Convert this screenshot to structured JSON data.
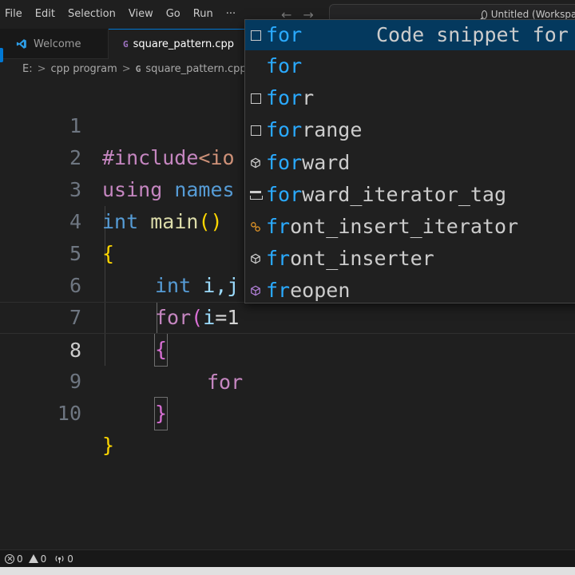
{
  "menubar": {
    "items": [
      "File",
      "Edit",
      "Selection",
      "View",
      "Go",
      "Run",
      "···"
    ],
    "back_arrow": "←",
    "forward_arrow": "→",
    "command_center_text": "Untitled (Workspace)"
  },
  "tabs": [
    {
      "label": "Welcome",
      "icon": "vscode-logo-icon",
      "active": false
    },
    {
      "label": "square_pattern.cpp",
      "icon": "cpp-file-icon",
      "active": true,
      "dirty": true
    }
  ],
  "breadcrumb": {
    "items": [
      "E:",
      "cpp program",
      "square_pattern.cpp"
    ],
    "separator": ">",
    "file_icon_text": "C+"
  },
  "editor": {
    "line_numbers": [
      "1",
      "2",
      "3",
      "4",
      "5",
      "6",
      "7",
      "8",
      "9",
      "10"
    ],
    "current_line": 8,
    "lines": {
      "l1": {
        "kw": "#include",
        "rest": "<io"
      },
      "l2": {
        "kw": "using",
        "sp": " ",
        "ns": "names"
      },
      "l3": {
        "type": "int",
        "sp": " ",
        "fn": "main",
        "paren": "()"
      },
      "l4": {
        "brace": "{"
      },
      "l5": {
        "type": "int",
        "sp": " ",
        "vars": "i,j"
      },
      "l6": {
        "kw": "for",
        "paren": "(",
        "var": "i",
        "rest": "=1"
      },
      "l7": {
        "brace": "{"
      },
      "l8": {
        "kw": "for"
      },
      "l9": {
        "brace": "}"
      },
      "l10": {
        "brace": "}"
      }
    }
  },
  "suggestions": {
    "items": [
      {
        "icon": "snippet-icon",
        "match": "for",
        "rest": "",
        "detail": "Code snippet for f",
        "selected": true
      },
      {
        "icon": "keyword-icon",
        "match": "for",
        "rest": ""
      },
      {
        "icon": "snippet-icon",
        "match": "for",
        "rest": "r"
      },
      {
        "icon": "snippet-icon",
        "match": "for",
        "rest": "range"
      },
      {
        "icon": "class-icon",
        "match": "for",
        "rest": "ward"
      },
      {
        "icon": "struct-icon",
        "match": "for",
        "rest": "ward_iterator_tag"
      },
      {
        "icon": "generic-class-icon",
        "match": "fr",
        "rest": "ont_insert_iterator"
      },
      {
        "icon": "class-icon",
        "match": "fr",
        "rest": "ont_inserter"
      },
      {
        "icon": "function-icon",
        "match": "fr",
        "rest": "eopen"
      }
    ]
  },
  "statusbar": {
    "errors": "0",
    "warnings": "0",
    "ports": "0"
  },
  "colors": {
    "accent": "#0078d4",
    "suggest_highlight": "#2aaaff",
    "selected_row": "#04395e"
  }
}
